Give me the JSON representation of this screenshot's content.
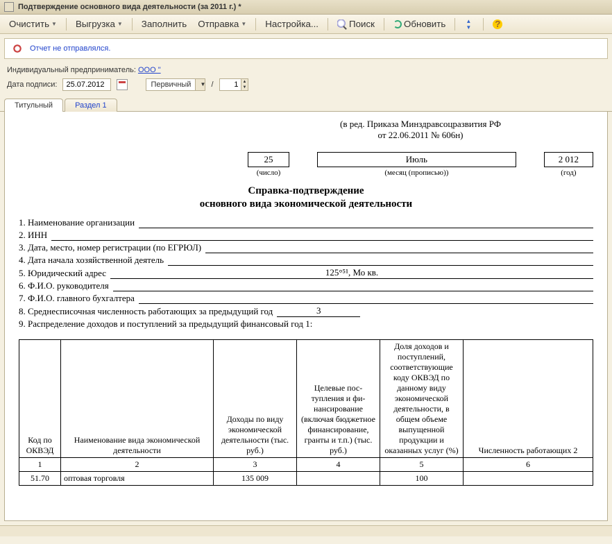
{
  "window": {
    "title": "Подтверждение основного вида деятельности  (за 2011 г.) *"
  },
  "toolbar": {
    "clear": "Очистить",
    "export": "Выгрузка",
    "fill": "Заполнить",
    "send": "Отправка",
    "settings": "Настройка...",
    "search": "Поиск",
    "refresh": "Обновить"
  },
  "status": {
    "text": "Отчет не отправлялся."
  },
  "meta": {
    "entrepreneur_label": "Индивидуальный предприниматель:",
    "entrepreneur_value": "ООО \"",
    "sign_date_label": "Дата подписи:",
    "sign_date": "25.07.2012",
    "kind": "Первичный",
    "slash": "/",
    "revision": "1"
  },
  "tabs": {
    "t1": "Титульный",
    "t2": "Раздел 1"
  },
  "doc": {
    "ред1": "(в ред. Приказа Минздравсоцразвития РФ",
    "ред2": "от 22.06.2011 № 606н)",
    "day": "25",
    "month": "Июль",
    "year": "2 012",
    "day_lbl": "(число)",
    "month_lbl": "(месяц (прописью))",
    "year_lbl": "(год)",
    "h1": "Справка-подтверждение",
    "h2": "основного вида экономической деятельности",
    "l1": "1. Наименование организации",
    "l2": "2. ИНН",
    "l3": "3. Дата, место, номер регистрации (по ЕГРЮЛ)",
    "l4": "4. Дата начала хозяйственной деятель",
    "l5": "5. Юридический адрес",
    "l6": "6. Ф.И.О. руководителя",
    "l7": "7. Ф.И.О. главного бухгалтера",
    "l8": "8. Среднесписочная численность работающих за предыдущий год",
    "l8v": "3",
    "l9": "9. Распределение доходов и поступлений за предыдущий финансовый год 1:",
    "v5": "125°⁵¹, Мо кв.",
    "th": {
      "c1": "Код по ОКВЭД",
      "c2": "Наименование вида экономической деятельности",
      "c3": "Доходы по виду экономической деятельности (тыс. руб.)",
      "c4": "Целевые пос­тупления и фи­нансирование (включая бюд­жетное фи­нансирование, гранты и т.п.) (тыс. руб.)",
      "c5": "Доля доходов и поступлений, соответствующие коду ОКВЭД по данному виду экономической деятельности, в общем объеме выпущенной продукции и оказанных услуг (%)",
      "c6": "Численность работающих 2"
    },
    "row_nums": {
      "c1": "1",
      "c2": "2",
      "c3": "3",
      "c4": "4",
      "c5": "5",
      "c6": "6"
    },
    "data_row": {
      "c1": "51.70",
      "c2": "оптовая торговля",
      "c3": "135 009",
      "c4": "",
      "c5": "100",
      "c6": ""
    }
  }
}
